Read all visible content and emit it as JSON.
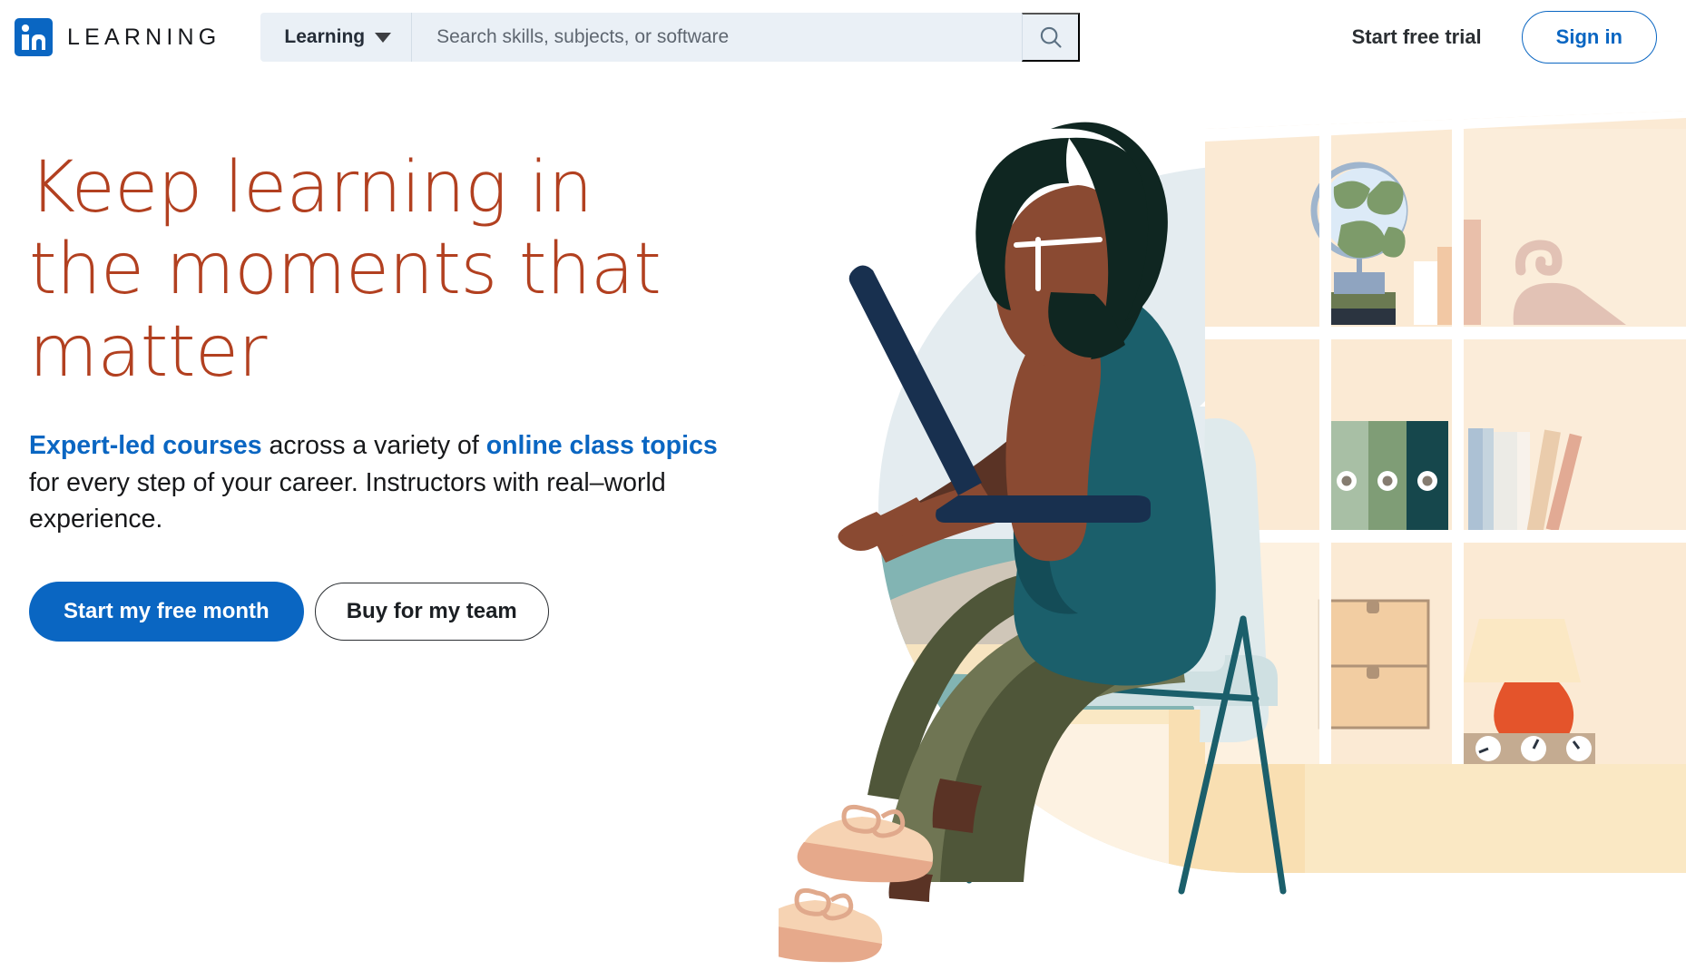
{
  "header": {
    "logo_icon": "linkedin-logo-icon",
    "brand_word": "LEARNING",
    "dropdown": {
      "label": "Learning",
      "caret_icon": "chevron-down-icon"
    },
    "search": {
      "placeholder": "Search skills, subjects, or software",
      "value": "",
      "button_icon": "search-icon"
    },
    "free_trial_label": "Start free trial",
    "sign_in_label": "Sign in"
  },
  "hero": {
    "headline": "Keep learning in the moments that matter",
    "subhead": {
      "link1": "Expert-led courses",
      "mid1": " across a variety of ",
      "link2": "online class topics",
      "tail": " for every step of your career. Instructors with real–world experience."
    },
    "primary_cta": "Start my free month",
    "secondary_cta": "Buy for my team",
    "illustration_name": "person-learning-on-laptop-illustration"
  },
  "colors": {
    "brand_blue": "#0a66c2",
    "headline_rust": "#b24020",
    "header_search_bg": "#eaf0f6",
    "text_dark": "#17181a",
    "sky": "#e3ebf0",
    "sea": "#7fb3b2",
    "sand": "#f6e2bd",
    "shelf": "#fbead4",
    "shirt_teal": "#1b5f6b",
    "pants_olive": "#6f7553",
    "skin": "#8a4a32",
    "laptop_navy": "#18304f",
    "lamp_orange": "#e4542b",
    "book_rust": "#c9674b",
    "chair_mint": "#cfe0e2"
  }
}
